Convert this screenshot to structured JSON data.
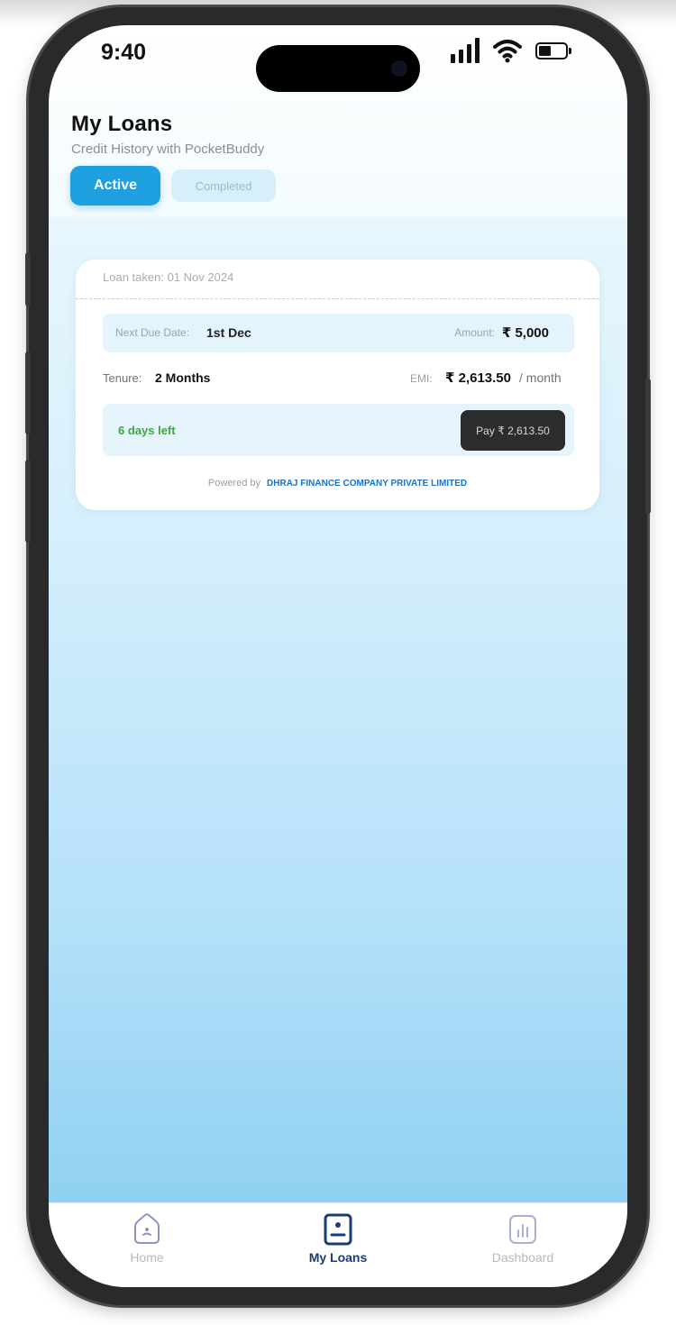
{
  "status_bar": {
    "time": "9:40"
  },
  "header": {
    "title": "My Loans",
    "subtitle": "Credit History with PocketBuddy"
  },
  "tabs": {
    "active": "Active",
    "completed": "Completed"
  },
  "loan_card": {
    "loan_taken_label": "Loan taken:",
    "loan_taken_date": "01 Nov 2024",
    "next_due_label": "Next Due Date:",
    "next_due_value": "1st Dec",
    "amount_label": "Amount:",
    "amount_value": "₹ 5,000",
    "tenure_label": "Tenure:",
    "tenure_value": "2 Months",
    "emi_label": "EMI:",
    "emi_value": "₹ 2,613.50",
    "emi_unit": "/ month",
    "days_left": "6 days left",
    "pay_button": "Pay ₹ 2,613.50",
    "powered_by_label": "Powered by",
    "lender_name": "DHRAJ FINANCE COMPANY PRIVATE LIMITED"
  },
  "bottom_nav": {
    "items": [
      {
        "label": "Home",
        "icon": "home-icon"
      },
      {
        "label": "My Loans",
        "icon": "loans-icon",
        "active": true
      },
      {
        "label": "Dashboard",
        "icon": "dashboard-icon"
      }
    ]
  },
  "colors": {
    "accent": "#1ea0e0",
    "days_left": "#3aa83a",
    "lender_link": "#1a73c6",
    "nav_active": "#1b3a7a"
  }
}
